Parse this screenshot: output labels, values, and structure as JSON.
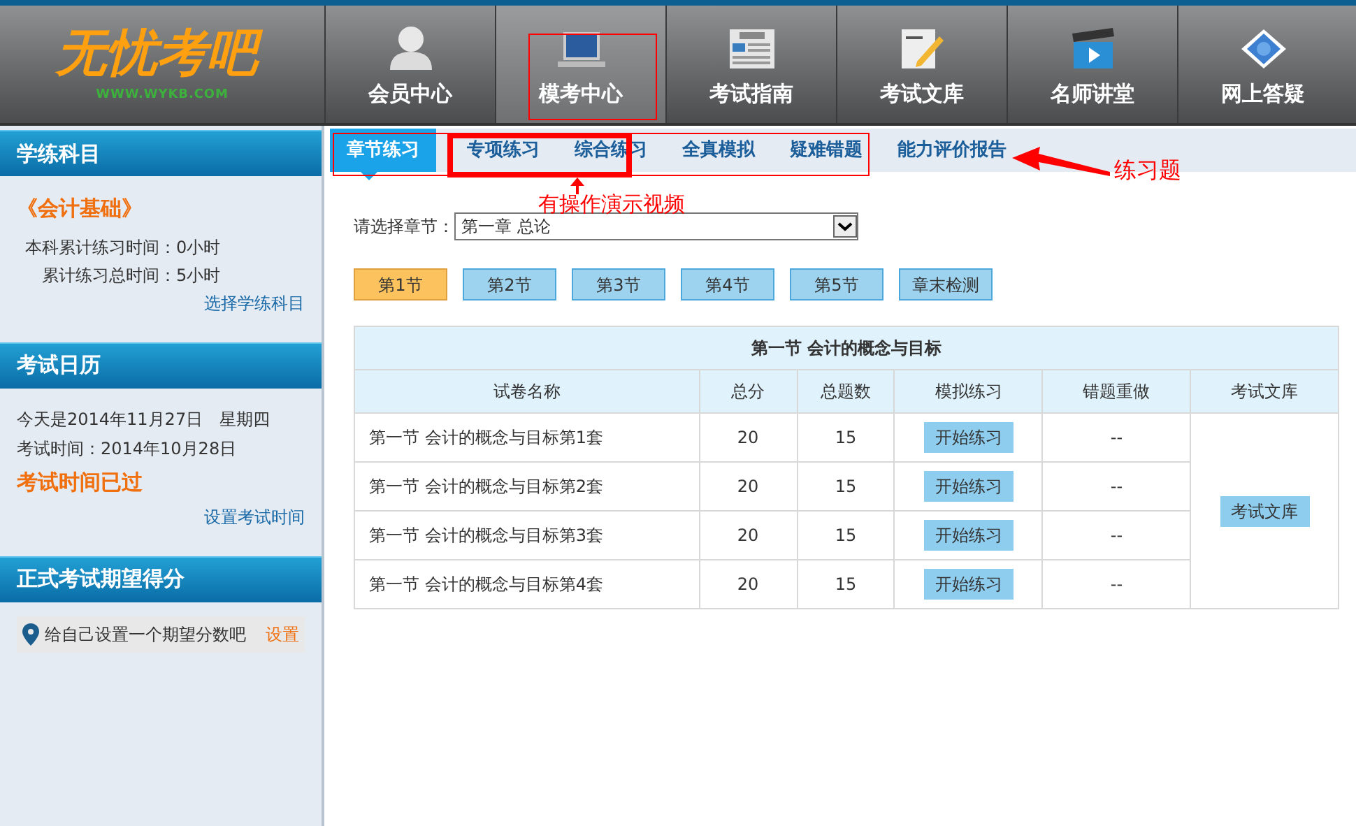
{
  "logo": {
    "title": "无忧考吧",
    "url": "WWW.WYKB.COM"
  },
  "nav": [
    {
      "label": "会员中心",
      "kind": "person",
      "selected": false
    },
    {
      "label": "模考中心",
      "kind": "laptop",
      "selected": true
    },
    {
      "label": "考试指南",
      "kind": "news",
      "selected": false
    },
    {
      "label": "考试文库",
      "kind": "notepad",
      "selected": false
    },
    {
      "label": "名师讲堂",
      "kind": "video",
      "selected": false
    },
    {
      "label": "网上答疑",
      "kind": "help",
      "selected": false
    }
  ],
  "subject_panel": {
    "title": "学练科目",
    "subject": "《会计基础》",
    "stats": [
      "本科累计练习时间：0小时",
      "累计练习总时间：5小时"
    ],
    "link": "选择学练科目"
  },
  "calendar_panel": {
    "title": "考试日历",
    "today": "今天是2014年11月27日　星期四",
    "exam_date": "考试时间：2014年10月28日",
    "status": "考试时间已过",
    "link": "设置考试时间"
  },
  "score_panel": {
    "title": "正式考试期望得分",
    "prompt": "给自己设置一个期望分数吧",
    "link": "设置"
  },
  "tabs": [
    {
      "label": "章节练习",
      "selected": true
    },
    {
      "label": "专项练习",
      "selected": false
    },
    {
      "label": "综合练习",
      "selected": false
    },
    {
      "label": "全真模拟",
      "selected": false
    },
    {
      "label": "疑难错题",
      "selected": false
    },
    {
      "label": "能力评价报告",
      "selected": false
    }
  ],
  "chapter_select": {
    "label": "请选择章节：",
    "value": "第一章 总论"
  },
  "sections": [
    {
      "label": "第1节",
      "selected": true
    },
    {
      "label": "第2节",
      "selected": false
    },
    {
      "label": "第3节",
      "selected": false
    },
    {
      "label": "第4节",
      "selected": false
    },
    {
      "label": "第5节",
      "selected": false
    },
    {
      "label": "章末检测",
      "selected": false
    }
  ],
  "table": {
    "title": "第一节  会计的概念与目标",
    "columns": [
      "试卷名称",
      "总分",
      "总题数",
      "模拟练习",
      "错题重做",
      "考试文库"
    ],
    "rows": [
      {
        "name": "第一节  会计的概念与目标第1套",
        "score": "20",
        "count": "15",
        "action": "开始练习",
        "redo": "--"
      },
      {
        "name": "第一节  会计的概念与目标第2套",
        "score": "20",
        "count": "15",
        "action": "开始练习",
        "redo": "--"
      },
      {
        "name": "第一节  会计的概念与目标第3套",
        "score": "20",
        "count": "15",
        "action": "开始练习",
        "redo": "--"
      },
      {
        "name": "第一节  会计的概念与目标第4套",
        "score": "20",
        "count": "15",
        "action": "开始练习",
        "redo": "--"
      }
    ],
    "library_button": "考试文库"
  },
  "annotations": {
    "video_note": "有操作演示视频",
    "exercise_note": "练习题"
  }
}
